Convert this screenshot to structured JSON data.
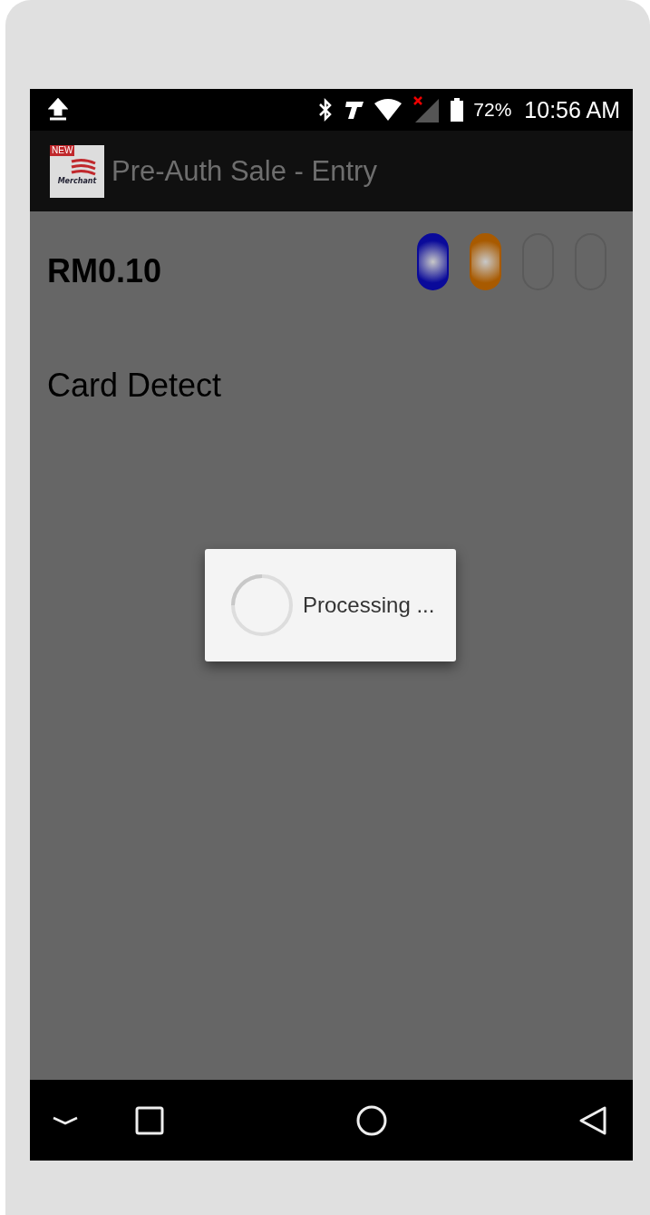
{
  "status_bar": {
    "battery": "72%",
    "time": "10:56 AM"
  },
  "app_bar": {
    "title": "Pre-Auth Sale - Entry",
    "logo_text": "Merchant",
    "logo_badge": "NEW"
  },
  "amount": "RM0.10",
  "indicators": [
    {
      "on": true,
      "color": "#0a0a9a"
    },
    {
      "on": true,
      "color": "#a85a00"
    },
    {
      "on": false,
      "color": "#666666"
    },
    {
      "on": false,
      "color": "#666666"
    }
  ],
  "message": "Card Detect",
  "dialog": {
    "text": "Processing ..."
  }
}
